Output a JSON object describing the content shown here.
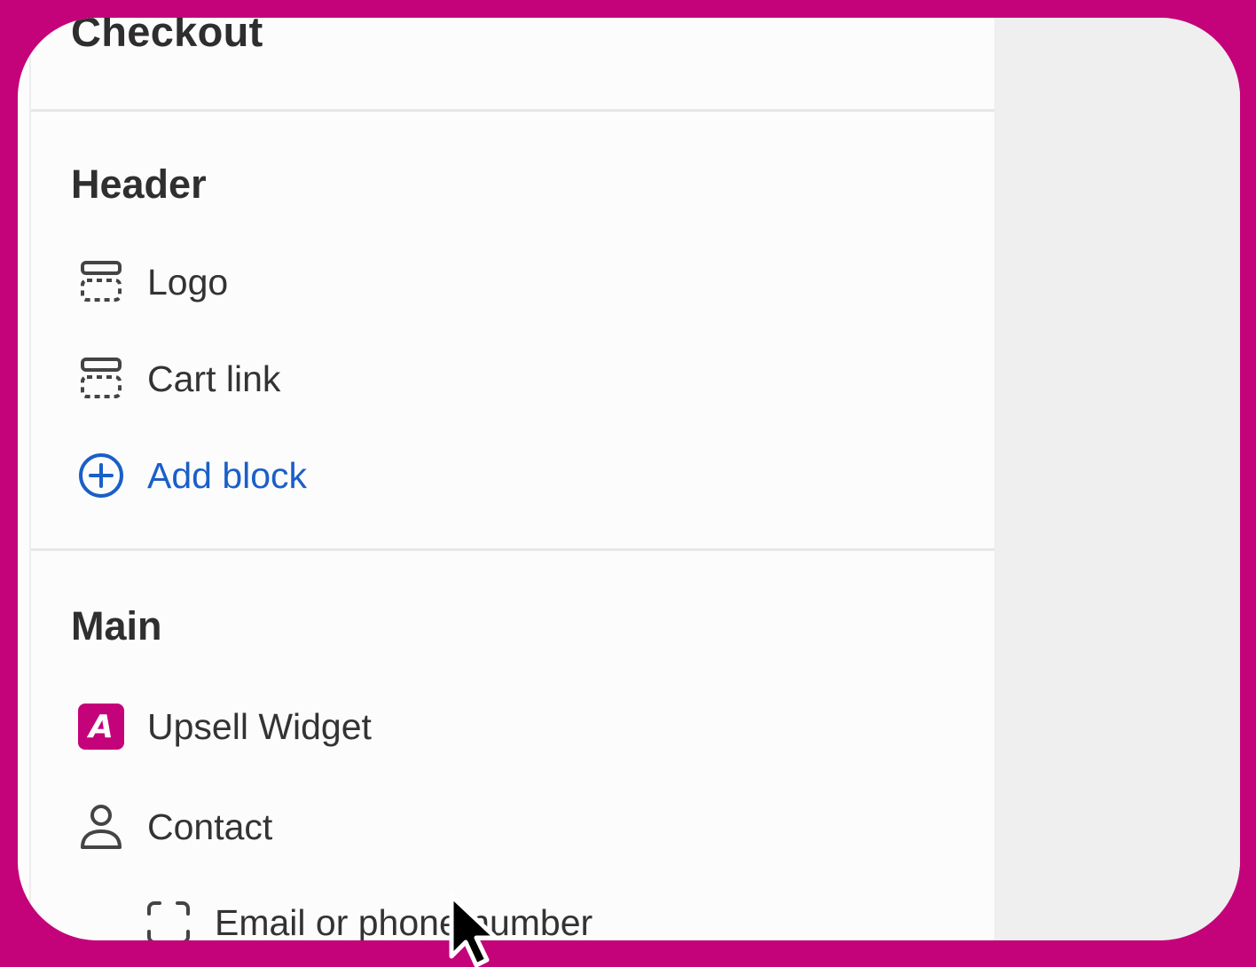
{
  "panel": {
    "title": "Checkout",
    "sections": [
      {
        "heading": "Header",
        "items": [
          {
            "label": "Logo",
            "icon": "dashed-block-icon"
          },
          {
            "label": "Cart link",
            "icon": "dashed-block-icon"
          },
          {
            "label": "Add block",
            "icon": "add-circle-icon",
            "color": "#1a5fc9"
          }
        ]
      },
      {
        "heading": "Main",
        "items": [
          {
            "label": "Upsell Widget",
            "icon": "app-logo-icon",
            "badge_text": "A",
            "color": "#C4027A"
          },
          {
            "label": "Contact",
            "icon": "person-icon"
          },
          {
            "label": "Email or phone number",
            "icon": "dashed-square-icon"
          }
        ]
      }
    ]
  },
  "colors": {
    "background_frame": "#C4027A",
    "panel_bg": "#fcfcfc",
    "preview_bg": "#efefef",
    "link": "#1a5fc9"
  }
}
